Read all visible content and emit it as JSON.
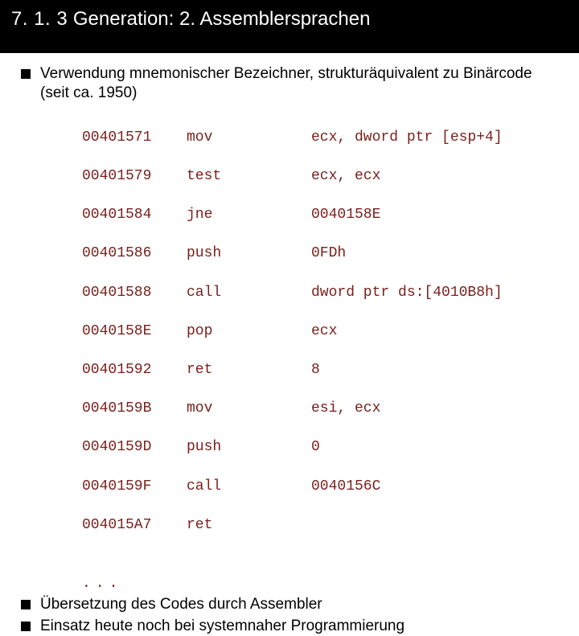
{
  "title": {
    "section": "7. 1. 3",
    "text": "Generation: 2. Assemblersprachen"
  },
  "bullets": {
    "b1": "Verwendung mnemonischer Bezeichner, strukturäquivalent zu Binärcode (seit ca. 1950)",
    "b2": "Übersetzung des Codes durch Assembler",
    "b3": "Einsatz heute noch bei systemnaher Programmierung"
  },
  "code": {
    "rows": [
      {
        "addr": "00401571",
        "op": "mov",
        "args": "ecx, dword ptr [esp+4]"
      },
      {
        "addr": "00401579",
        "op": "test",
        "args": "ecx, ecx"
      },
      {
        "addr": "00401584",
        "op": "jne",
        "args": "0040158E"
      },
      {
        "addr": "00401586",
        "op": "push",
        "args": "0FDh"
      },
      {
        "addr": "00401588",
        "op": "call",
        "args": "dword ptr ds:[4010B8h]"
      },
      {
        "addr": "0040158E",
        "op": "pop",
        "args": "ecx"
      },
      {
        "addr": "00401592",
        "op": "ret",
        "args": "8"
      },
      {
        "addr": "0040159B",
        "op": "mov",
        "args": "esi, ecx"
      },
      {
        "addr": "0040159D",
        "op": "push",
        "args": "0"
      },
      {
        "addr": "0040159F",
        "op": "call",
        "args": "0040156C"
      },
      {
        "addr": "004015A7",
        "op": "ret",
        "args": ""
      }
    ],
    "ellipsis": "..."
  }
}
